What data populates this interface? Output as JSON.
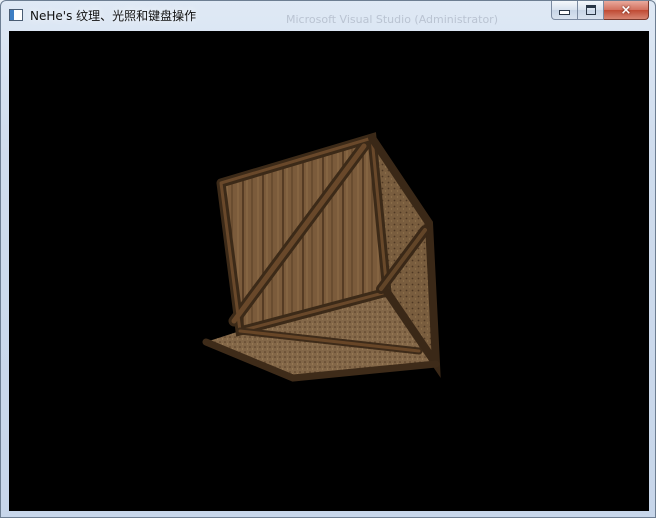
{
  "window": {
    "title": "NeHe's 纹理、光照和键盘操作",
    "background_title_ghost": "Microsoft Visual Studio (Administrator)",
    "caption_buttons": {
      "minimize": "minimize-icon",
      "maximize": "maximize-icon",
      "close": "×"
    }
  },
  "viewport": {
    "background_color": "#000000",
    "object": "textured-wooden-crate",
    "wood_colors": [
      "#7a5a3a",
      "#5e4227",
      "#3b2816",
      "#9a7a52"
    ]
  }
}
